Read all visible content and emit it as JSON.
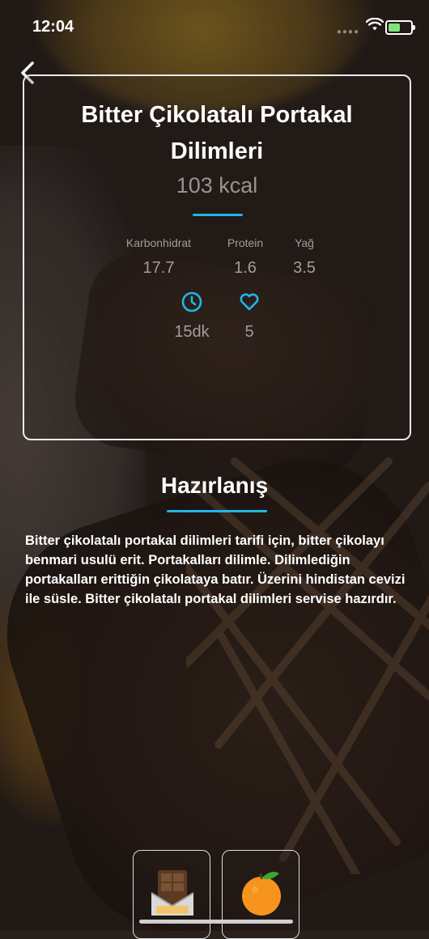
{
  "status_bar": {
    "time": "12:04"
  },
  "recipe": {
    "title": "Bitter Çikolatalı Portakal Dilimleri",
    "calories": "103 kcal",
    "macros": [
      {
        "label": "Karbonhidrat",
        "value": "17.7"
      },
      {
        "label": "Protein",
        "value": "1.6"
      },
      {
        "label": "Yağ",
        "value": "3.5"
      }
    ],
    "duration": "15dk",
    "likes": "5"
  },
  "preparation": {
    "heading": "Hazırlanış",
    "text": "Bitter çikolatalı portakal dilimleri tarifi için, bitter çikolayı benmari usulü erit. Portakalları dilimle. Dilimlediğin portakalları erittiğin çikolataya batır. Üzerini hindistan cevizi ile süsle. Bitter çikolatalı portakal dilimleri servise hazırdır."
  },
  "ingredients": [
    {
      "icon": "chocolate-bar-icon"
    },
    {
      "icon": "orange-icon"
    }
  ],
  "colors": {
    "accent": "#1fb7e8",
    "battery": "#7ee27a"
  }
}
